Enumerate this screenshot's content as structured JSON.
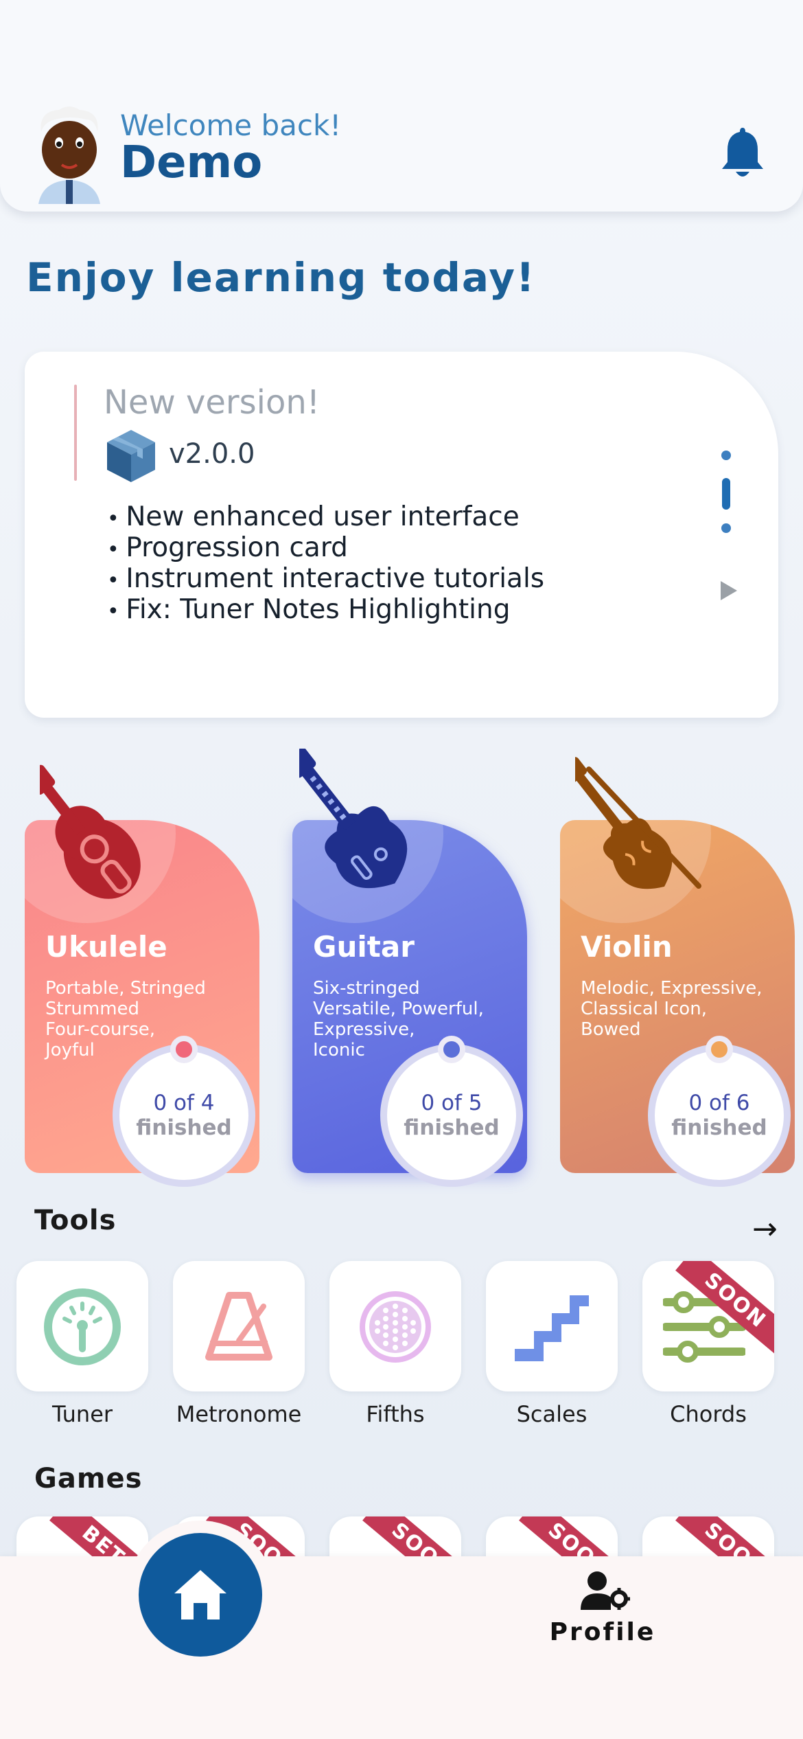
{
  "header": {
    "welcome": "Welcome back!",
    "username": "Demo"
  },
  "greeting": "Enjoy learning today!",
  "news": {
    "title": "New version!",
    "version": "v2.0.0",
    "items": [
      "New enhanced user interface",
      "Progression card",
      "Instrument interactive tutorials",
      "Fix: Tuner Notes Highlighting"
    ]
  },
  "instruments": [
    {
      "name": "Ukulele",
      "description": "Portable, Stringed\nStrummed\nFour-course,\nJoyful",
      "progress": "0 of 4",
      "progress_label": "finished",
      "color": "#f9858a",
      "knob_color": "#f0677a"
    },
    {
      "name": "Guitar",
      "description": "Six-stringed\nVersatile, Powerful,\nExpressive,\nIconic",
      "progress": "0 of 5",
      "progress_label": "finished",
      "color": "#5863de",
      "knob_color": "#5b6fd8"
    },
    {
      "name": "Violin",
      "description": "Melodic, Expressive,\nClassical Icon,\nBowed",
      "progress": "0 of 6",
      "progress_label": "finished",
      "color": "#e09868",
      "knob_color": "#f0a45a"
    }
  ],
  "tools": {
    "title": "Tools",
    "items": [
      {
        "label": "Tuner",
        "icon": "gauge-icon"
      },
      {
        "label": "Metronome",
        "icon": "metronome-icon"
      },
      {
        "label": "Fifths",
        "icon": "circle-of-fifths-icon"
      },
      {
        "label": "Scales",
        "icon": "stairs-icon"
      },
      {
        "label": "Chords",
        "icon": "sliders-icon",
        "badge": "SOON"
      }
    ]
  },
  "games": {
    "title": "Games",
    "badges": [
      "BETA",
      "SOON",
      "SOON",
      "SOON",
      "SOON"
    ]
  },
  "nav": {
    "home_icon": "home-icon",
    "profile_label": "Profile"
  }
}
